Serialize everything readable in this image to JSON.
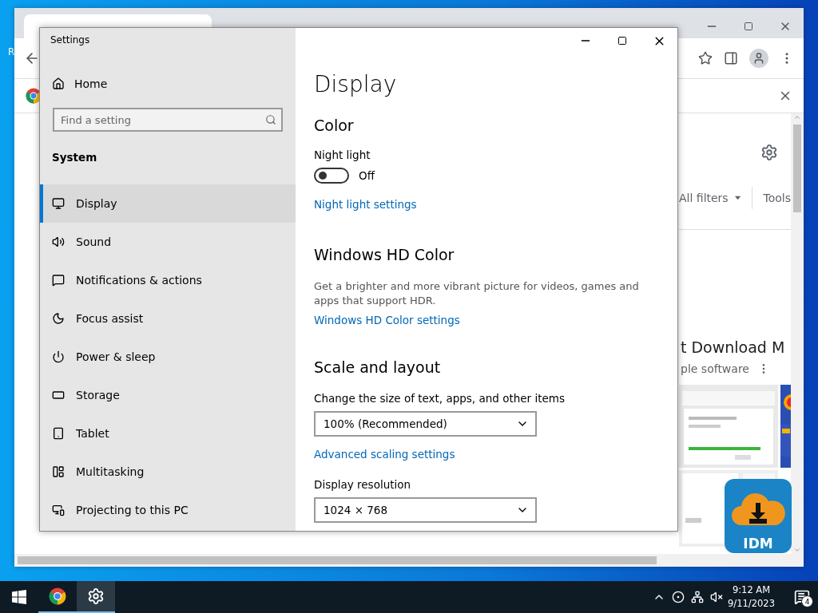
{
  "desktop": {
    "icon_labels": [
      "R"
    ]
  },
  "browser": {
    "filters_label": "All filters",
    "tools_label": "Tools",
    "result_title": "t Download M",
    "result_subtitle": "ple software",
    "logo_text": "IDM"
  },
  "settings": {
    "title": "Settings",
    "home": "Home",
    "search": {
      "placeholder": "Find a setting"
    },
    "section": "System",
    "nav": [
      {
        "label": "Display",
        "selected": true
      },
      {
        "label": "Sound",
        "selected": false
      },
      {
        "label": "Notifications & actions",
        "selected": false
      },
      {
        "label": "Focus assist",
        "selected": false
      },
      {
        "label": "Power & sleep",
        "selected": false
      },
      {
        "label": "Storage",
        "selected": false
      },
      {
        "label": "Tablet",
        "selected": false
      },
      {
        "label": "Multitasking",
        "selected": false
      },
      {
        "label": "Projecting to this PC",
        "selected": false
      }
    ],
    "page": {
      "title": "Display",
      "color_heading": "Color",
      "night_light": {
        "label": "Night light",
        "on": false,
        "state_text": "Off"
      },
      "night_light_link": "Night light settings",
      "hd_heading": "Windows HD Color",
      "hd_description": "Get a brighter and more vibrant picture for videos, games and apps that support HDR.",
      "hd_link": "Windows HD Color settings",
      "scale_heading": "Scale and layout",
      "scale_label": "Change the size of text, apps, and other items",
      "scale_value": "100% (Recommended)",
      "scaling_link": "Advanced scaling settings",
      "resolution_label": "Display resolution",
      "resolution_value": "1024 × 768"
    }
  },
  "taskbar": {
    "apps": [
      {
        "kind": "chrome",
        "selected": false
      },
      {
        "kind": "settings",
        "selected": true
      }
    ],
    "time": "9:12 AM",
    "date": "9/11/2023",
    "notification_count": "4"
  }
}
